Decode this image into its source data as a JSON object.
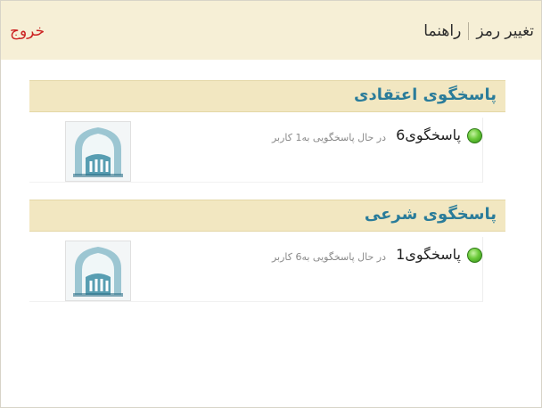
{
  "header": {
    "help_label": "راهنما",
    "change_password_label": "تغییر رمز",
    "logout_label": "خروج"
  },
  "sections": [
    {
      "title": "پاسخگوی اعتقادی",
      "agent": {
        "name": "پاسخگوی6",
        "status": "در حال پاسخگویی به1 کاربر"
      }
    },
    {
      "title": "پاسخگوی شرعی",
      "agent": {
        "name": "پاسخگوی1",
        "status": "در حال پاسخگویی به6 کاربر"
      }
    }
  ],
  "colors": {
    "topbar": "#f6efd6",
    "section_header": "#f2e7c1",
    "section_title": "#2a7c9a",
    "logout": "#cc2222",
    "online": "#4caf2a"
  },
  "icons": {
    "status": "online-status-icon",
    "thumb": "mosque-logo-icon"
  }
}
